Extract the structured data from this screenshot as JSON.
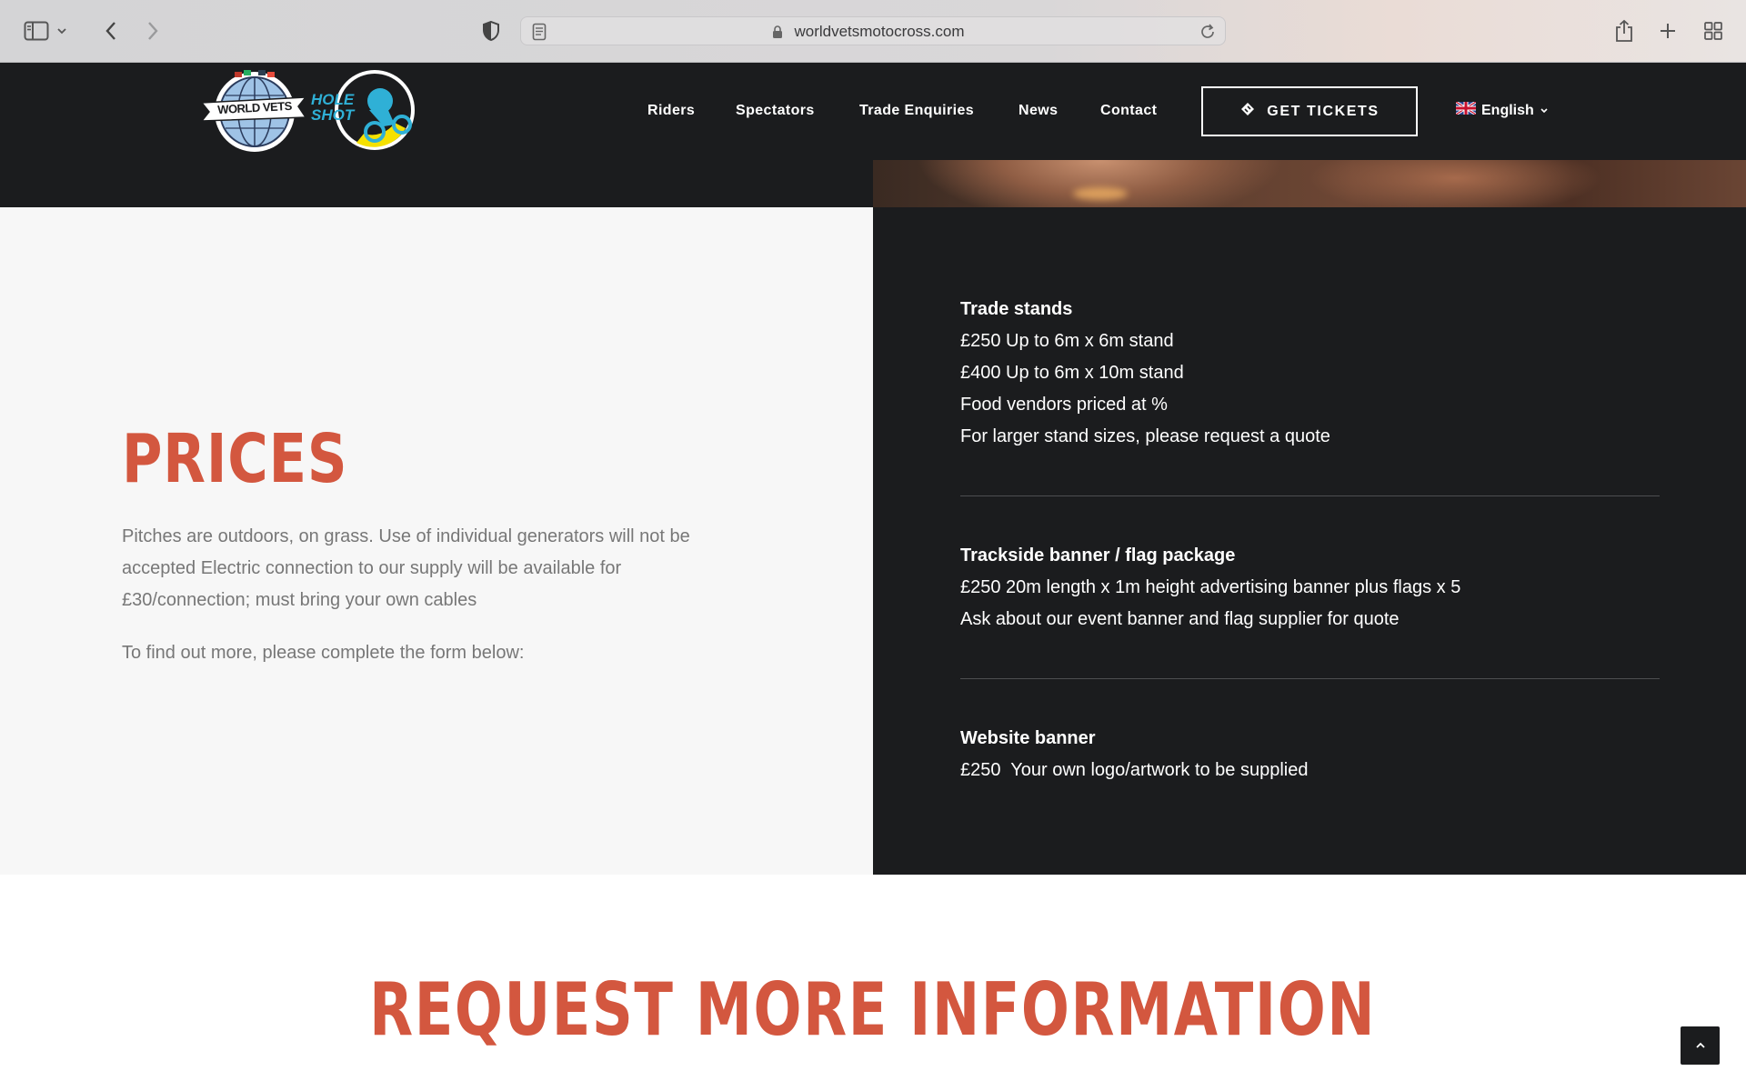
{
  "browser": {
    "url": "worldvetsmotocross.com",
    "icons": [
      "sidebar-icon",
      "chevron-down-icon",
      "back-icon",
      "forward-icon",
      "shield-icon",
      "reader-icon",
      "lock-icon",
      "reload-icon",
      "share-icon",
      "plus-icon",
      "tab-grid-icon"
    ]
  },
  "header": {
    "nav": [
      "Riders",
      "Spectators",
      "Trade Enquiries",
      "News",
      "Contact"
    ],
    "tickets_label": "GET TICKETS",
    "language": "English",
    "logo_worldvets_text": "WORLD VETS",
    "logo_holeshot_text": "HOLE SHOT"
  },
  "prices": {
    "title": "PRICES",
    "paragraph1": "Pitches are outdoors, on grass. Use of individual generators will not be accepted Electric connection to our supply will be available for £30/connection; must bring your own cables",
    "paragraph2": "To find out more, please complete the form below:",
    "blocks": [
      {
        "title": "Trade stands",
        "lines": [
          "£250 Up to 6m x 6m stand",
          "£400 Up to 6m x 10m stand",
          "Food vendors priced at %",
          "For larger stand sizes, please request a quote"
        ]
      },
      {
        "title": "Trackside banner / flag package",
        "lines": [
          "£250 20m length x 1m height advertising banner plus flags x 5",
          "Ask about our event banner and flag supplier for quote"
        ]
      },
      {
        "title": "Website banner",
        "lines": [
          "£250  Your own logo/artwork to be supplied"
        ]
      }
    ]
  },
  "request": {
    "title": "REQUEST MORE INFORMATION"
  },
  "colors": {
    "accent": "#d3573f",
    "dark": "#1b1c1e",
    "light_bg": "#f7f7f7"
  }
}
